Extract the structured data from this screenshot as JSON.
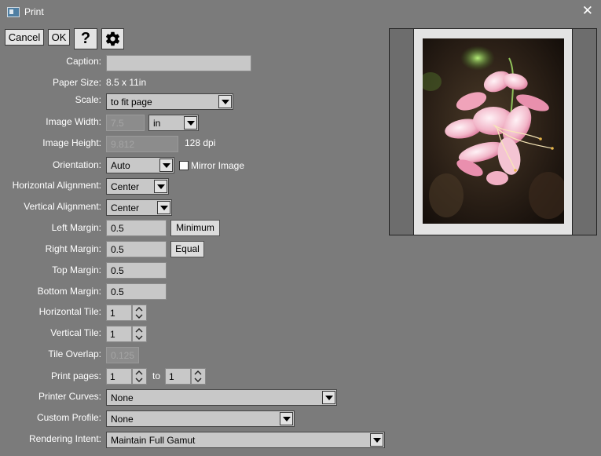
{
  "window": {
    "title": "Print",
    "close_glyph": "✕"
  },
  "toolbar": {
    "cancel_label": "Cancel",
    "ok_label": "OK",
    "help_label": "?",
    "settings_icon": "gear-icon"
  },
  "caption": {
    "label": "Caption:",
    "value": ""
  },
  "paper_size": {
    "label": "Paper Size:",
    "value": "8.5 x 11in"
  },
  "scale": {
    "label": "Scale:",
    "value": "to fit page"
  },
  "image_width": {
    "label": "Image Width:",
    "value": "7.5",
    "unit": "in"
  },
  "image_height": {
    "label": "Image Height:",
    "value": "9.812",
    "dpi": "128 dpi"
  },
  "orientation": {
    "label": "Orientation:",
    "value": "Auto",
    "mirror_label": "Mirror Image",
    "mirror_checked": false
  },
  "horizontal_alignment": {
    "label": "Horizontal Alignment:",
    "value": "Center"
  },
  "vertical_alignment": {
    "label": "Vertical Alignment:",
    "value": "Center"
  },
  "left_margin": {
    "label": "Left Margin:",
    "value": "0.5",
    "button": "Minimum"
  },
  "right_margin": {
    "label": "Right Margin:",
    "value": "0.5",
    "button": "Equal"
  },
  "top_margin": {
    "label": "Top Margin:",
    "value": "0.5"
  },
  "bottom_margin": {
    "label": "Bottom Margin:",
    "value": "0.5"
  },
  "horizontal_tile": {
    "label": "Horizontal Tile:",
    "value": "1"
  },
  "vertical_tile": {
    "label": "Vertical Tile:",
    "value": "1"
  },
  "tile_overlap": {
    "label": "Tile Overlap:",
    "value": "0.125"
  },
  "print_pages": {
    "label": "Print pages:",
    "from": "1",
    "to_label": "to",
    "to": "1"
  },
  "printer_curves": {
    "label": "Printer Curves:",
    "value": "None"
  },
  "custom_profile": {
    "label": "Custom Profile:",
    "value": "None"
  },
  "rendering_intent": {
    "label": "Rendering Intent:",
    "value": "Maintain Full Gamut"
  },
  "colors": {
    "background": "#7b7b7b",
    "field": "#c8c8c8",
    "button": "#e4e4e4",
    "paper": "#e3e3e3"
  }
}
